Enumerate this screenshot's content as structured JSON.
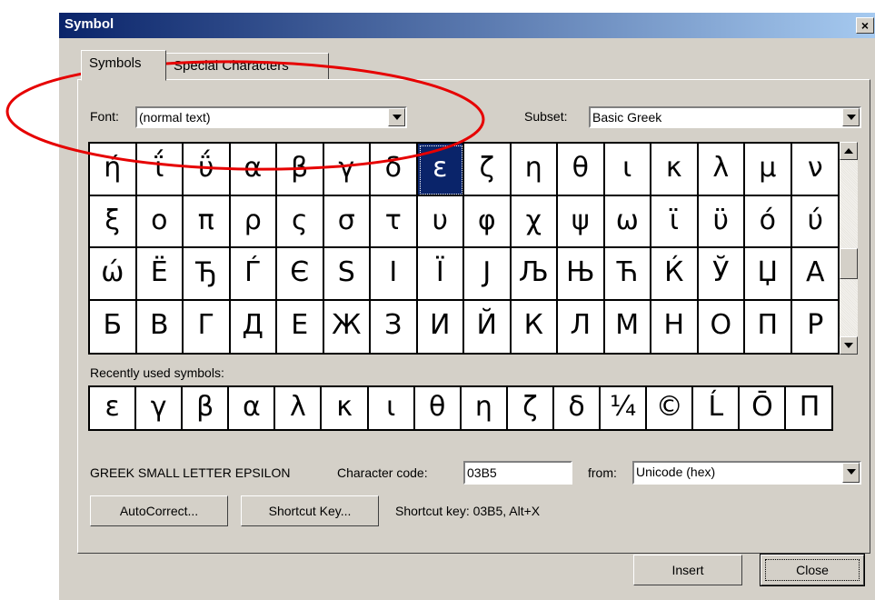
{
  "window": {
    "title": "Symbol",
    "close_glyph": "×"
  },
  "tabs": [
    {
      "label": "Symbols"
    },
    {
      "label": "Special Characters"
    }
  ],
  "font": {
    "label": "Font:",
    "value": "(normal text)"
  },
  "subset": {
    "label": "Subset:",
    "value": "Basic Greek"
  },
  "symbol_grid": {
    "rows": [
      [
        "ή",
        "ΐ",
        "ΰ",
        "α",
        "β",
        "γ",
        "δ",
        "ε",
        "ζ",
        "η",
        "θ",
        "ι",
        "κ",
        "λ",
        "μ",
        "ν"
      ],
      [
        "ξ",
        "ο",
        "π",
        "ρ",
        "ς",
        "σ",
        "τ",
        "υ",
        "φ",
        "χ",
        "ψ",
        "ω",
        "ϊ",
        "ϋ",
        "ό",
        "ύ"
      ],
      [
        "ώ",
        "Ё",
        "Ђ",
        "Ѓ",
        "Є",
        "Ѕ",
        "І",
        "Ї",
        "Ј",
        "Љ",
        "Њ",
        "Ћ",
        "Ќ",
        "Ў",
        "Џ",
        "А"
      ],
      [
        "Б",
        "В",
        "Г",
        "Д",
        "Е",
        "Ж",
        "З",
        "И",
        "Й",
        "К",
        "Л",
        "М",
        "Н",
        "О",
        "П",
        "Р"
      ]
    ],
    "selected": "ε"
  },
  "recent": {
    "label": "Recently used symbols:",
    "symbols": [
      "ε",
      "γ",
      "β",
      "α",
      "λ",
      "κ",
      "ι",
      "θ",
      "η",
      "ζ",
      "δ",
      "¼",
      "©",
      "Ĺ",
      "Ō",
      "Π"
    ]
  },
  "char_info": {
    "name": "GREEK SMALL LETTER EPSILON",
    "code_label": "Character code:",
    "code_value": "03B5",
    "from_label": "from:",
    "from_value": "Unicode (hex)"
  },
  "buttons": {
    "autocorrect": "AutoCorrect...",
    "shortcut_key": "Shortcut Key...",
    "shortcut_text": "Shortcut key: 03B5, Alt+X",
    "insert": "Insert",
    "close": "Close"
  },
  "colors": {
    "titlebar": "#0a246a",
    "selection": "#0a246a",
    "face": "#d4d0c8",
    "annotation": "#e60000"
  }
}
